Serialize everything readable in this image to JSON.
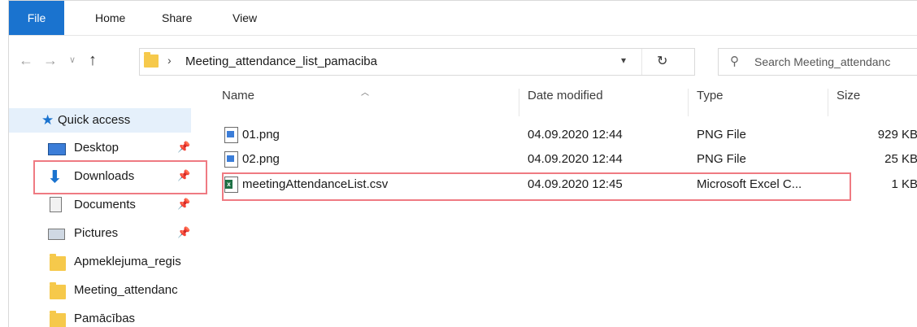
{
  "ribbon": {
    "tabs": [
      "File",
      "Home",
      "Share",
      "View"
    ]
  },
  "address": {
    "path": "Meeting_attendance_list_pamaciba",
    "search_placeholder": "Search Meeting_attendanc"
  },
  "nav": {
    "quick_access": "Quick access",
    "items": [
      {
        "label": "Desktop",
        "icon": "desktop-icon",
        "pinned": true
      },
      {
        "label": "Downloads",
        "icon": "download-arrow-icon",
        "pinned": true
      },
      {
        "label": "Documents",
        "icon": "documents-icon",
        "pinned": true
      },
      {
        "label": "Pictures",
        "icon": "pictures-icon",
        "pinned": true
      },
      {
        "label": "Apmeklejuma_regis",
        "icon": "folder-icon",
        "pinned": false
      },
      {
        "label": "Meeting_attendanc",
        "icon": "folder-icon",
        "pinned": false
      },
      {
        "label": "Pamācības",
        "icon": "folder-icon",
        "pinned": false
      }
    ]
  },
  "columns": {
    "name": "Name",
    "date": "Date modified",
    "type": "Type",
    "size": "Size"
  },
  "files": [
    {
      "name": "01.png",
      "date": "04.09.2020 12:44",
      "type": "PNG File",
      "size": "929 KB",
      "icon": "png-file-icon"
    },
    {
      "name": "02.png",
      "date": "04.09.2020 12:44",
      "type": "PNG File",
      "size": "25 KB",
      "icon": "png-file-icon"
    },
    {
      "name": "meetingAttendanceList.csv",
      "date": "04.09.2020 12:45",
      "type": "Microsoft Excel C...",
      "size": "1 KB",
      "icon": "excel-csv-file-icon"
    }
  ],
  "colors": {
    "file_tab": "#1a73cf",
    "highlight": "#ef7a82",
    "folder": "#f6c94b"
  }
}
